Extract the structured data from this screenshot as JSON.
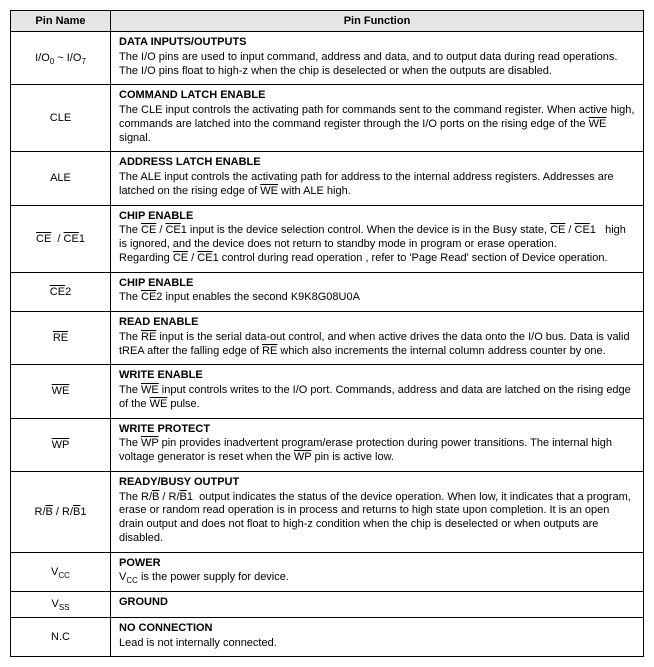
{
  "headers": {
    "pin": "Pin Name",
    "func": "Pin Function"
  },
  "rows": [
    {
      "pin_html": "I/O<span class='sub'>0</span> ~ I/O<span class='sub'>7</span>",
      "title": "DATA INPUTS/OUTPUTS",
      "desc_html": "The I/O pins are used to input command, address and data, and to output data during read operations. The I/O pins float to high-z when the chip is deselected or when the outputs are disabled."
    },
    {
      "pin_html": "CLE",
      "title": "COMMAND LATCH ENABLE",
      "desc_html": "The CLE input controls the activating path for commands sent to the command register. When active high, commands are latched into the command register through the I/O ports on the rising edge of the <span class='ovl'>WE</span> signal."
    },
    {
      "pin_html": "ALE",
      "title": "ADDRESS LATCH ENABLE",
      "desc_html": "The ALE input controls the activating path for address to the internal address registers. Addresses are latched on the rising edge of <span class='ovl'>WE</span> with ALE high."
    },
    {
      "pin_html": "<span class='ovl'>CE</span>&nbsp; / <span class='ovl'>CE</span>1",
      "title": "CHIP ENABLE",
      "desc_html": "The <span class='ovl'>CE</span> / <span class='ovl'>CE</span>1 input is the device selection control. When the device is in the Busy state, <span class='ovl'>CE</span> / <span class='ovl'>CE</span>1&nbsp;&nbsp; high is ignored, and the device does not return to standby mode in program or erase operation.<br>Regarding <span class='ovl'>CE</span> / <span class='ovl'>CE</span>1 control during read operation , refer to 'Page Read' section of Device operation."
    },
    {
      "pin_html": "<span class='ovl'>CE</span>2",
      "title": "CHIP ENABLE",
      "desc_html": "The <span class='ovl'>CE</span>2 input enables the second K9K8G08U0A"
    },
    {
      "pin_html": "<span class='ovl'>RE</span>",
      "title": "READ ENABLE",
      "desc_html": "The <span class='ovl'>RE</span> input is the serial data-out control, and when active drives the data onto the I/O bus. Data is valid tREA after the falling edge of <span class='ovl'>RE</span> which also increments the internal column address counter by one."
    },
    {
      "pin_html": "<span class='ovl'>WE</span>",
      "title": "WRITE ENABLE",
      "desc_html": "The <span class='ovl'>WE</span> input controls writes to the I/O port. Commands, address and data are latched on the rising edge of the <span class='ovl'>WE</span> pulse."
    },
    {
      "pin_html": "<span class='ovl'>WP</span>",
      "title": "WRITE PROTECT",
      "desc_html": "The <span class='ovl'>WP</span> pin provides inadvertent program/erase protection during power transitions. The internal high voltage generator is reset when the <span class='ovl'>WP</span> pin is active low."
    },
    {
      "pin_html": "R/<span class='ovl'>B</span> / R/<span class='ovl'>B</span>1",
      "title": "READY/BUSY OUTPUT",
      "desc_html": "The R/<span class='ovl'>B</span> / R/<span class='ovl'>B</span>1&nbsp; output indicates the status of the device operation. When low, it indicates that a program, erase or random read operation is in process and returns to high state upon completion. It is an open drain output and does not float to high-z condition when the chip is deselected or when outputs are disabled."
    },
    {
      "pin_html": "V<span class='sub'>CC</span>",
      "title": "POWER",
      "desc_html": "V<span class='sub'>CC</span> is the power supply for device."
    },
    {
      "pin_html": "V<span class='sub'>SS</span>",
      "title": "GROUND",
      "desc_html": ""
    },
    {
      "pin_html": "N.C",
      "title": "NO CONNECTION",
      "desc_html": "Lead is not internally connected."
    }
  ]
}
